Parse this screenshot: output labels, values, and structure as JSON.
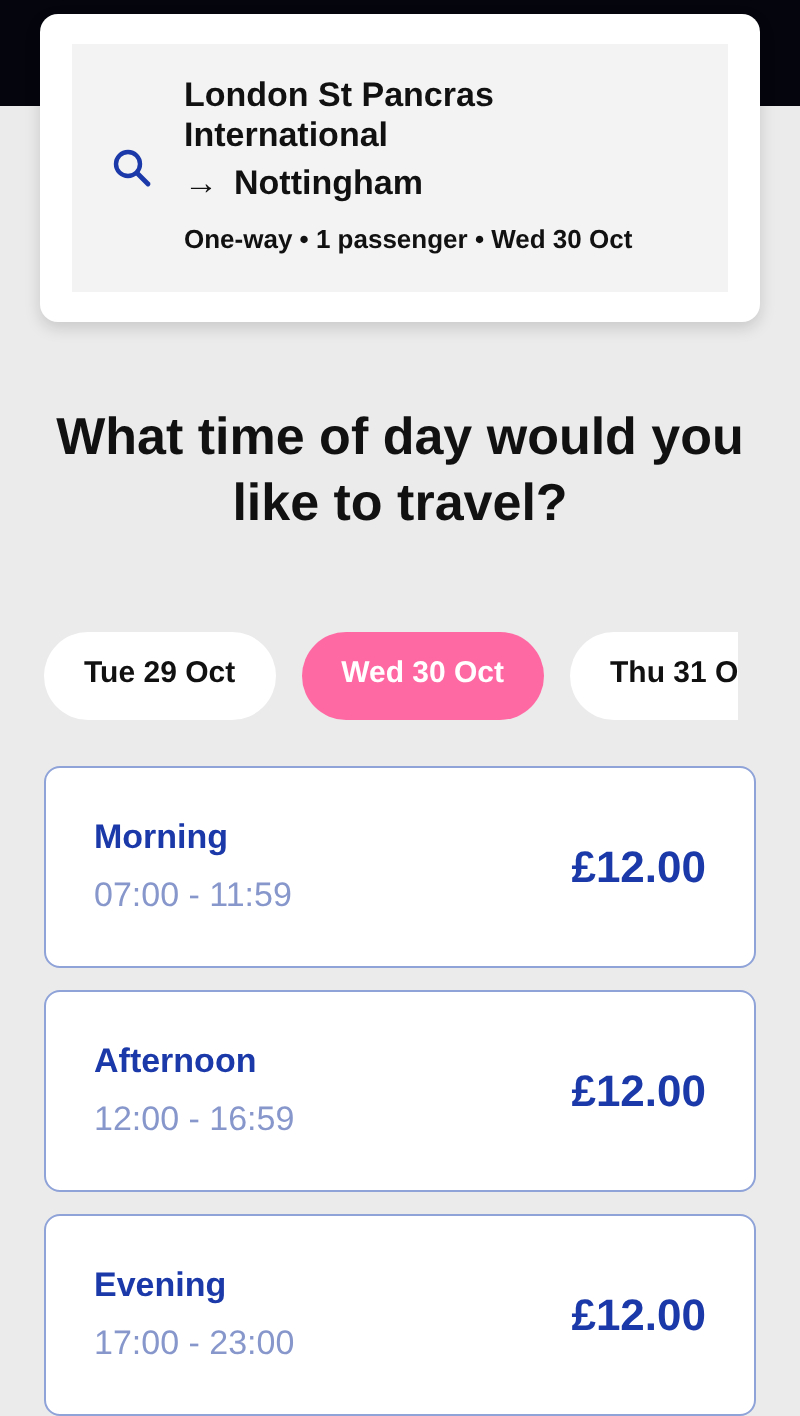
{
  "journey": {
    "origin": "London St Pancras International",
    "arrow": "→",
    "destination": "Nottingham",
    "details": [
      "One-way",
      "1 passenger",
      "Wed 30 Oct"
    ],
    "separator": "•"
  },
  "heading": "What time of day would you like to travel?",
  "dates": [
    {
      "label": "Tue 29 Oct",
      "selected": false
    },
    {
      "label": "Wed 30 Oct",
      "selected": true
    },
    {
      "label": "Thu 31 O",
      "selected": false
    }
  ],
  "slots": [
    {
      "name": "Morning",
      "hours": "07:00 - 11:59",
      "price": "£12.00"
    },
    {
      "name": "Afternoon",
      "hours": "12:00 - 16:59",
      "price": "£12.00"
    },
    {
      "name": "Evening",
      "hours": "17:00 - 23:00",
      "price": "£12.00"
    }
  ]
}
